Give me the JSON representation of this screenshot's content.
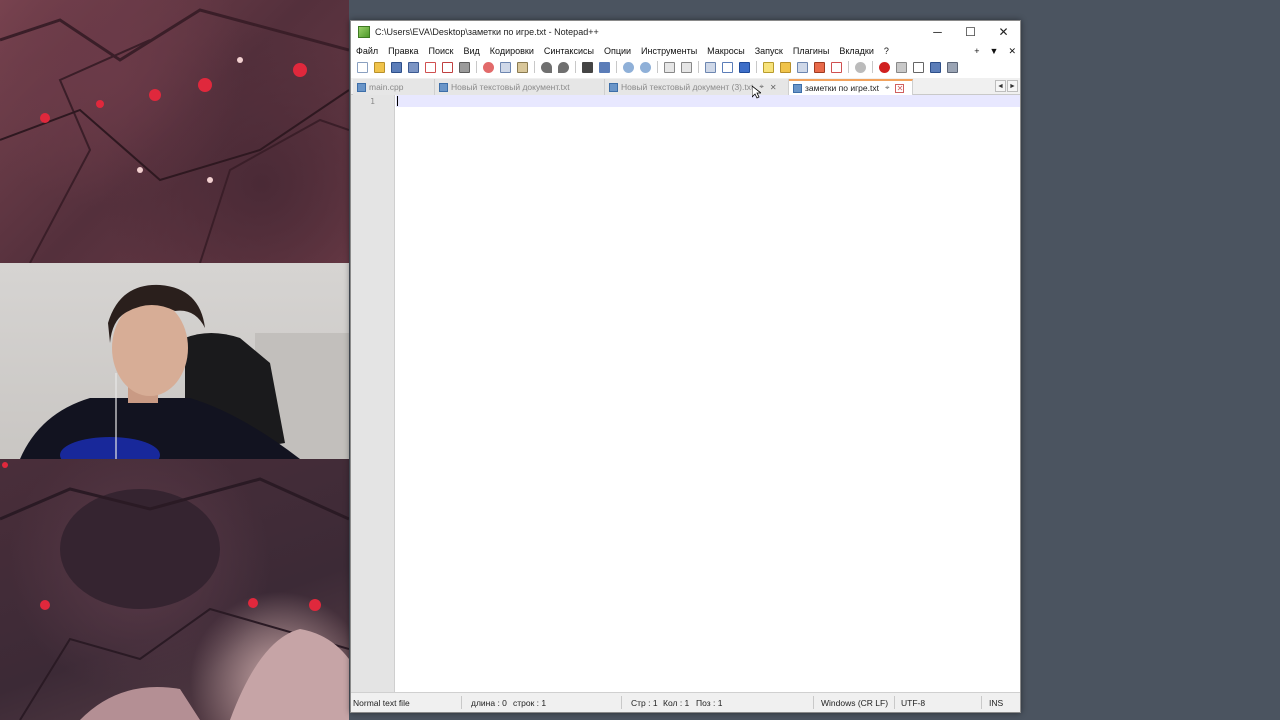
{
  "window": {
    "title": "C:\\Users\\EVA\\Desktop\\заметки по игре.txt - Notepad++",
    "controls": {
      "minimize": "─",
      "maximize": "☐",
      "close": "✕"
    }
  },
  "menu": {
    "items": [
      "Файл",
      "Правка",
      "Поиск",
      "Вид",
      "Кодировки",
      "Синтаксисы",
      "Опции",
      "Инструменты",
      "Макросы",
      "Запуск",
      "Плагины",
      "Вкладки",
      "?"
    ],
    "right": {
      "add": "+",
      "dropdown": "▼",
      "close": "✕"
    }
  },
  "toolbar": {
    "icons": [
      "new-file-icon",
      "open-file-icon",
      "save-icon",
      "save-all-icon",
      "close-icon",
      "close-all-icon",
      "print-icon",
      "cut-icon",
      "copy-icon",
      "paste-icon",
      "undo-icon",
      "redo-icon",
      "find-icon",
      "replace-icon",
      "zoom-in-icon",
      "zoom-out-icon",
      "sync-vertical-icon",
      "sync-horizontal-icon",
      "word-wrap-icon",
      "show-all-chars-icon",
      "indent-guide-icon",
      "function-list-icon",
      "folder-workspace-icon",
      "doc-map-icon",
      "monitor-icon",
      "record-macro-icon",
      "stop-macro-icon",
      "play-macro-icon",
      "run-macro-icon",
      "save-macro-icon"
    ]
  },
  "tabs": [
    {
      "label": "main.cpp",
      "active": false
    },
    {
      "label": "Новый текстовый документ.txt",
      "active": false
    },
    {
      "label": "Новый текстовый документ (3).txt",
      "active": false
    },
    {
      "label": "заметки по игре.txt",
      "active": true
    }
  ],
  "tab_controls": {
    "pin": "📌",
    "close": "✕",
    "scroll_left": "◄",
    "scroll_right": "►"
  },
  "editor": {
    "line_number": "1",
    "content": ""
  },
  "status": {
    "file_type": "Normal text file",
    "length": "длина : 0",
    "lines": "строк : 1",
    "line": "Стр : 1",
    "col": "Кол : 1",
    "pos": "Поз : 1",
    "eol": "Windows (CR LF)",
    "encoding": "UTF-8",
    "mode": "INS"
  },
  "colors": {
    "desktop": "#4b5460",
    "active_tab_accent": "#f2a25c",
    "current_line": "#e8e8ff",
    "gutter": "#e4e4e4"
  }
}
